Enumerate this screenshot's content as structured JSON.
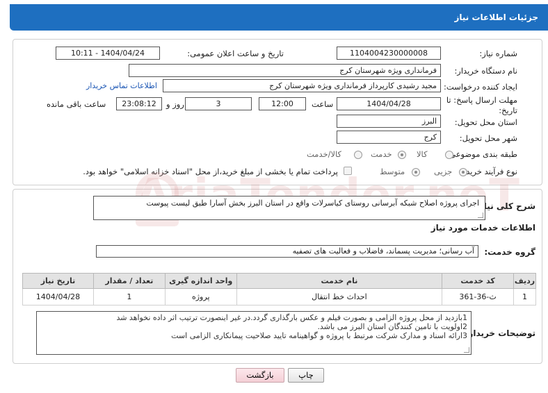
{
  "header": {
    "title": "جزئیات اطلاعات نیاز"
  },
  "form": {
    "need_number_label": "شماره نیاز:",
    "need_number": "1104004230000008",
    "announce_label": "تاریخ و ساعت اعلان عمومی:",
    "announce_value": "1404/04/24 - 10:11",
    "buyer_org_label": "نام دستگاه خریدار:",
    "buyer_org": "فرمانداری ویژه شهرستان کرج",
    "creator_label": "ایجاد کننده درخواست:",
    "creator": "مجید رشیدی کارپرداز فرمانداری ویژه شهرستان کرج",
    "contact_link": "اطلاعات تماس خریدار",
    "deadline_label_1": "مهلت ارسال پاسخ: تا",
    "deadline_label_2": "تاریخ:",
    "deadline_date": "1404/04/28",
    "time_label": "ساعت",
    "deadline_time": "12:00",
    "days_value": "3",
    "days_label": "روز و",
    "remaining_time": "23:08:12",
    "remaining_label": "ساعت باقی مانده",
    "province_label": "استان محل تحویل:",
    "province": "البرز",
    "city_label": "شهر محل تحویل:",
    "city": "کرج",
    "category_label": "طبقه بندی موضوعی:",
    "category_options": [
      "کالا",
      "خدمت",
      "کالا/خدمت"
    ],
    "category_selected": "خدمت",
    "process_label": "نوع فرآیند خرید :",
    "process_options": [
      "جزیی",
      "متوسط"
    ],
    "process_selected": "جزیی",
    "payment_note": "پرداخت تمام یا بخشی از مبلغ خرید،از محل \"اسناد خزانه اسلامی\" خواهد بود."
  },
  "summary": {
    "label": "شرح کلی نیاز:",
    "value": "اجرای پروژه اصلاح شبکه آبرسانی روستای کیاسرلات واقع در استان البرز بخش آسارا طبق لیست پیوست"
  },
  "services": {
    "section_title": "اطلاعات خدمات مورد نیاز",
    "group_label": "گروه خدمت:",
    "group_value": "آب رسانی؛ مدیریت پسماند، فاضلاب و فعالیت های تصفیه",
    "columns": [
      "ردیف",
      "کد خدمت",
      "نام خدمت",
      "واحد اندازه گیری",
      "تعداد / مقدار",
      "تاریخ نیاز"
    ],
    "rows": [
      [
        "1",
        "ث-36-361",
        "احداث خط انتقال",
        "پروژه",
        "1",
        "1404/04/28"
      ]
    ]
  },
  "notes": {
    "label": "توضیحات خریدار:",
    "lines": [
      "1بازدید از محل پروژه الزامی و بصورت فیلم و عکس بارگذاری گردد.در غیر اینصورت ترتیب اثر داده نخواهد شد",
      "2اولویت با تامین کنندگان استان البرز می باشد.",
      "3ارائه اسناد و مدارک شرکت مرتبط با پروژه و گواهینامه تایید صلاحیت پیمانکاری الزامی است"
    ]
  },
  "buttons": {
    "print": "چاپ",
    "back": "بازگشت"
  },
  "watermark": {
    "text": "AriaTender.neT"
  }
}
